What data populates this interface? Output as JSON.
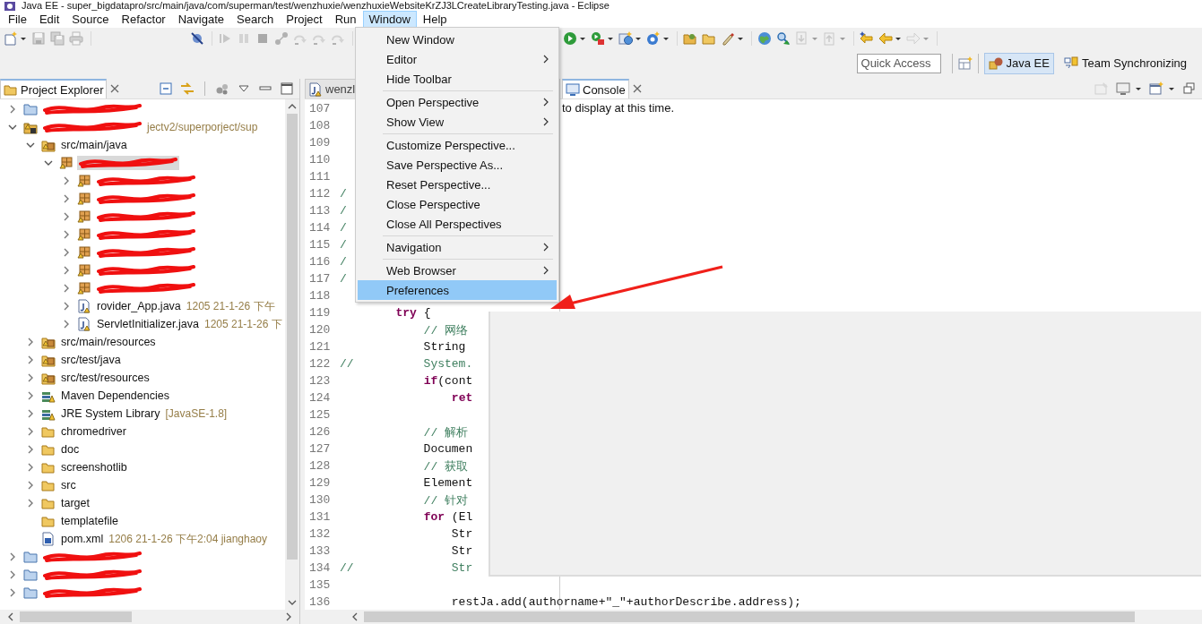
{
  "window": {
    "title": "Java EE - super_bigdatapro/src/main/java/com/superman/test/wenzhuxie/wenzhuxieWebsiteKrZJ3LCreateLibraryTesting.java - Eclipse"
  },
  "menu_bar": [
    {
      "label": "File",
      "selected": false
    },
    {
      "label": "Edit",
      "selected": false
    },
    {
      "label": "Source",
      "selected": false
    },
    {
      "label": "Refactor",
      "selected": false
    },
    {
      "label": "Navigate",
      "selected": false
    },
    {
      "label": "Search",
      "selected": false
    },
    {
      "label": "Project",
      "selected": false
    },
    {
      "label": "Run",
      "selected": false
    },
    {
      "label": "Window",
      "selected": true
    },
    {
      "label": "Help",
      "selected": false
    }
  ],
  "open_menu": {
    "items": [
      {
        "kind": "item",
        "label": "New Window",
        "submenu": false,
        "selected": false
      },
      {
        "kind": "item",
        "label": "Editor",
        "submenu": true,
        "selected": false
      },
      {
        "kind": "item",
        "label": "Hide Toolbar",
        "submenu": false,
        "selected": false
      },
      {
        "kind": "separator"
      },
      {
        "kind": "item",
        "label": "Open Perspective",
        "submenu": true,
        "selected": false
      },
      {
        "kind": "item",
        "label": "Show View",
        "submenu": true,
        "selected": false
      },
      {
        "kind": "separator"
      },
      {
        "kind": "item",
        "label": "Customize Perspective...",
        "submenu": false,
        "selected": false
      },
      {
        "kind": "item",
        "label": "Save Perspective As...",
        "submenu": false,
        "selected": false
      },
      {
        "kind": "item",
        "label": "Reset Perspective...",
        "submenu": false,
        "selected": false
      },
      {
        "kind": "item",
        "label": "Close Perspective",
        "submenu": false,
        "selected": false
      },
      {
        "kind": "item",
        "label": "Close All Perspectives",
        "submenu": false,
        "selected": false
      },
      {
        "kind": "separator"
      },
      {
        "kind": "item",
        "label": "Navigation",
        "submenu": true,
        "selected": false
      },
      {
        "kind": "separator"
      },
      {
        "kind": "item",
        "label": "Web Browser",
        "submenu": true,
        "selected": false
      },
      {
        "kind": "item",
        "label": "Preferences",
        "submenu": false,
        "selected": true
      }
    ]
  },
  "toolbar": {
    "left": [
      [
        {
          "kind": "new",
          "dropdown": true,
          "disabled": false
        },
        {
          "kind": "save",
          "dropdown": false,
          "disabled": true
        },
        {
          "kind": "save_all",
          "dropdown": false,
          "disabled": true
        },
        {
          "kind": "print",
          "dropdown": false,
          "disabled": true
        }
      ],
      [
        {
          "kind": "skip",
          "dropdown": false,
          "disabled": false
        }
      ],
      [
        {
          "kind": "resume",
          "dropdown": false,
          "disabled": true
        },
        {
          "kind": "suspend",
          "dropdown": false,
          "disabled": true
        },
        {
          "kind": "terminate",
          "dropdown": false,
          "disabled": true
        },
        {
          "kind": "disconnect",
          "dropdown": false,
          "disabled": true
        },
        {
          "kind": "step",
          "dropdown": false,
          "disabled": true
        },
        {
          "kind": "step",
          "dropdown": false,
          "disabled": true
        },
        {
          "kind": "step",
          "dropdown": false,
          "disabled": true
        }
      ]
    ],
    "right": [
      [
        {
          "kind": "run",
          "dropdown": true,
          "disabled": false
        },
        {
          "kind": "debug",
          "dropdown": true,
          "disabled": false
        },
        {
          "kind": "server",
          "dropdown": true,
          "disabled": false
        },
        {
          "kind": "class",
          "dropdown": true,
          "disabled": false
        }
      ],
      [
        {
          "kind": "open_folder",
          "dropdown": false,
          "disabled": false
        },
        {
          "kind": "folder",
          "dropdown": false,
          "disabled": false
        },
        {
          "kind": "pen",
          "dropdown": true,
          "disabled": false
        }
      ],
      [
        {
          "kind": "globe",
          "dropdown": false,
          "disabled": false
        },
        {
          "kind": "search",
          "dropdown": false,
          "disabled": false
        },
        {
          "kind": "page_down",
          "dropdown": true,
          "disabled": true
        },
        {
          "kind": "page_up",
          "dropdown": true,
          "disabled": true
        }
      ],
      [
        {
          "kind": "last_edit",
          "dropdown": false,
          "disabled": false
        },
        {
          "kind": "back",
          "dropdown": true,
          "disabled": false
        },
        {
          "kind": "forward",
          "dropdown": true,
          "disabled": true
        }
      ]
    ]
  },
  "quick_access": {
    "placeholder": "Quick Access"
  },
  "perspectives": [
    {
      "label": "Java EE",
      "kind": "java_ee",
      "selected": true
    },
    {
      "label": "Team Synchronizing",
      "kind": "team",
      "selected": false
    }
  ],
  "project_explorer": {
    "tab": {
      "label": "Project Explorer",
      "selected": true
    },
    "tree": [
      {
        "kind": "closed_project",
        "redacted": true,
        "expanded": false,
        "selected": false
      },
      {
        "kind": "maven_project",
        "redacted": true,
        "decoration": "jectv2/superporject/sup",
        "expanded": true,
        "selected": false,
        "children": [
          {
            "label": "src/main/java",
            "kind": "source_folder",
            "redacted": false,
            "expanded": true,
            "selected": false,
            "children": [
              {
                "kind": "package",
                "redacted": true,
                "expanded": true,
                "selected": true,
                "children": [
                  {
                    "kind": "package",
                    "redacted": true,
                    "expanded": false,
                    "selected": false
                  },
                  {
                    "kind": "package",
                    "redacted": true,
                    "expanded": false,
                    "selected": false
                  },
                  {
                    "kind": "package",
                    "redacted": true,
                    "expanded": false,
                    "selected": false
                  },
                  {
                    "kind": "package",
                    "redacted": true,
                    "expanded": false,
                    "selected": false
                  },
                  {
                    "kind": "package",
                    "redacted": true,
                    "expanded": false,
                    "selected": false
                  },
                  {
                    "kind": "package",
                    "redacted": true,
                    "expanded": false,
                    "selected": false
                  },
                  {
                    "kind": "package",
                    "redacted": true,
                    "expanded": false,
                    "selected": false
                  },
                  {
                    "label": "rovider_App.java",
                    "kind": "java",
                    "redacted": false,
                    "decoration": "1205  21-1-26 下午",
                    "expanded": false,
                    "selected": false
                  },
                  {
                    "label": "ServletInitializer.java",
                    "kind": "java",
                    "redacted": false,
                    "decoration": "1205  21-1-26 下",
                    "expanded": false,
                    "selected": false
                  }
                ]
              }
            ]
          },
          {
            "label": "src/main/resources",
            "kind": "source_folder",
            "redacted": false,
            "expanded": false,
            "selected": false
          },
          {
            "label": "src/test/java",
            "kind": "source_folder",
            "redacted": false,
            "expanded": false,
            "selected": false
          },
          {
            "label": "src/test/resources",
            "kind": "source_folder",
            "redacted": false,
            "expanded": false,
            "selected": false
          },
          {
            "label": "Maven Dependencies",
            "kind": "library",
            "redacted": false,
            "expanded": false,
            "selected": false
          },
          {
            "label": "JRE System Library",
            "kind": "library",
            "redacted": false,
            "decoration": "[JavaSE-1.8]",
            "expanded": false,
            "selected": false
          },
          {
            "label": "chromedriver",
            "kind": "folder",
            "redacted": false,
            "expanded": false,
            "selected": false
          },
          {
            "label": "doc",
            "kind": "folder",
            "redacted": false,
            "expanded": false,
            "selected": false
          },
          {
            "label": "screenshotlib",
            "kind": "folder",
            "redacted": false,
            "expanded": false,
            "selected": false
          },
          {
            "label": "src",
            "kind": "folder",
            "redacted": false,
            "expanded": false,
            "selected": false
          },
          {
            "label": "target",
            "kind": "folder",
            "redacted": false,
            "expanded": false,
            "selected": false
          },
          {
            "label": "templatefile",
            "kind": "folder",
            "redacted": false,
            "selected": false
          },
          {
            "label": "pom.xml",
            "kind": "xml",
            "redacted": false,
            "decoration": "1206  21-1-26 下午2:04  jianghaoy",
            "selected": false
          }
        ]
      },
      {
        "kind": "closed_project",
        "redacted": true,
        "expanded": false,
        "selected": false
      },
      {
        "kind": "closed_project",
        "redacted": true,
        "expanded": false,
        "selected": false
      },
      {
        "kind": "closed_project",
        "redacted": true,
        "expanded": false,
        "selected": false
      }
    ]
  },
  "editor": {
    "tab": {
      "label": "wenzl",
      "selected": false
    },
    "lines": [
      {
        "number": "107"
      },
      {
        "number": "108"
      },
      {
        "number": "109"
      },
      {
        "number": "110"
      },
      {
        "number": "111"
      },
      {
        "number": "112",
        "kind": "comment",
        "text": "/"
      },
      {
        "number": "113",
        "kind": "comment",
        "text": "/"
      },
      {
        "number": "114",
        "kind": "comment",
        "text": "/"
      },
      {
        "number": "115",
        "kind": "comment",
        "text": "/"
      },
      {
        "number": "116",
        "kind": "comment",
        "text": "/"
      },
      {
        "number": "117",
        "kind": "comment",
        "text": "/"
      },
      {
        "number": "118"
      },
      {
        "number": "119",
        "kind": "code",
        "text": "        **try** {"
      },
      {
        "number": "120",
        "kind": "comment",
        "text": "            // 网络"
      },
      {
        "number": "121",
        "kind": "code",
        "text": "            String"
      },
      {
        "number": "122",
        "kind": "comment",
        "text": "//          System."
      },
      {
        "number": "123",
        "kind": "code",
        "text": "            **if**(cont"
      },
      {
        "number": "124",
        "kind": "code",
        "text": "                **ret**"
      },
      {
        "number": "125"
      },
      {
        "number": "126",
        "kind": "comment",
        "text": "            // 解析"
      },
      {
        "number": "127",
        "kind": "code",
        "text": "            Documen"
      },
      {
        "number": "128",
        "kind": "comment",
        "text": "            // 获取"
      },
      {
        "number": "129",
        "kind": "code",
        "text": "            Element"
      },
      {
        "number": "130",
        "kind": "comment",
        "text": "            // 针对"
      },
      {
        "number": "131",
        "kind": "code",
        "text": "            **for** (El"
      },
      {
        "number": "132",
        "kind": "code",
        "text": "                Str"
      },
      {
        "number": "133",
        "kind": "code",
        "text": "                Str"
      },
      {
        "number": "134",
        "kind": "comment",
        "text": "//              Str"
      },
      {
        "number": "135"
      },
      {
        "number": "136",
        "kind": "code",
        "text": "                restJa.add(authorname+\"_\"+authorDescribe.address);"
      }
    ]
  },
  "console": {
    "tab": {
      "label": "Console",
      "selected": true
    },
    "message": "to display at this time."
  }
}
